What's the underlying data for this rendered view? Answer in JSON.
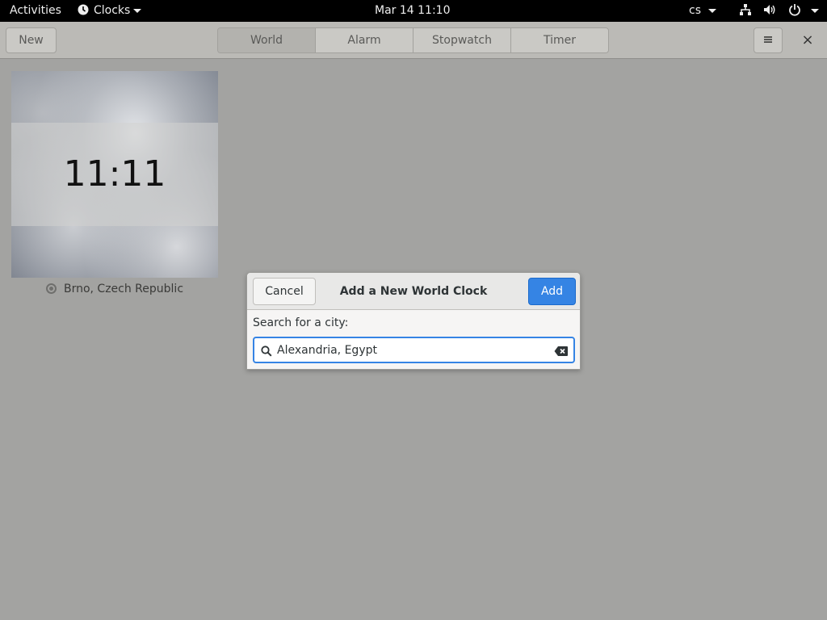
{
  "topbar": {
    "activities": "Activities",
    "app_menu": "Clocks",
    "datetime": "Mar 14  11:10",
    "language": "cs",
    "icons": [
      "clock-icon",
      "network-icon",
      "volume-icon",
      "power-icon"
    ]
  },
  "header": {
    "new_label": "New",
    "tabs": [
      {
        "label": "World",
        "active": true
      },
      {
        "label": "Alarm",
        "active": false
      },
      {
        "label": "Stopwatch",
        "active": false
      },
      {
        "label": "Timer",
        "active": false
      }
    ],
    "menu_icon": "hamburger-icon",
    "close_label": "×"
  },
  "world": {
    "clocks": [
      {
        "time": "11:11",
        "city": "Brno, Czech Republic"
      }
    ]
  },
  "dialog": {
    "cancel_label": "Cancel",
    "title": "Add a New World Clock",
    "add_label": "Add",
    "search_label": "Search for a city:",
    "search_value": "Alexandria, Egypt"
  },
  "colors": {
    "accent": "#3584e4",
    "topbar_bg": "#000000",
    "window_dim_bg": "#a3a3a1"
  }
}
